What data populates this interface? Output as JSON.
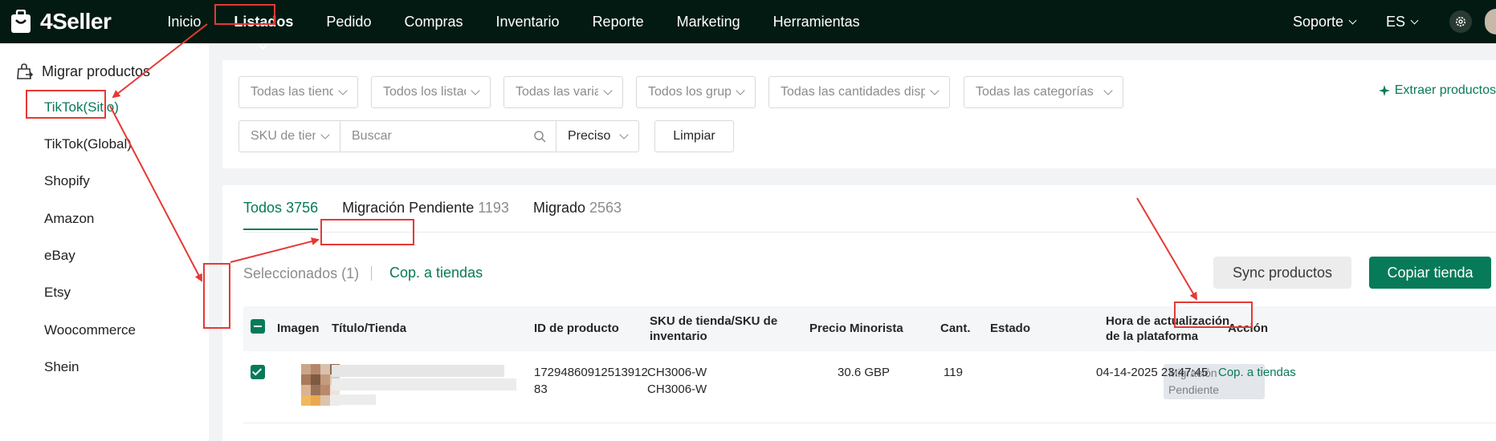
{
  "brand": {
    "name": "4Seller"
  },
  "nav": {
    "items": [
      "Inicio",
      "Listados",
      "Pedido",
      "Compras",
      "Inventario",
      "Reporte",
      "Marketing",
      "Herramientas"
    ],
    "active": "Listados",
    "support": "Soporte",
    "language": "ES"
  },
  "sidebar": {
    "header": "Migrar productos",
    "items": [
      "TikTok(Sitio)",
      "TikTok(Global)",
      "Shopify",
      "Amazon",
      "eBay",
      "Etsy",
      "Woocommerce",
      "Shein"
    ],
    "active": "TikTok(Sitio)"
  },
  "filters": {
    "stores": "Todas las tiendas",
    "listings": "Todos los listados",
    "variants": "Todas las variantes",
    "groups": "Todos los grupos",
    "quantities": "Todas las cantidades disponibles",
    "categories": "Todas las categorías",
    "sku_type": "SKU de tienda",
    "search_placeholder": "Buscar",
    "match": "Preciso",
    "clear": "Limpiar",
    "extract": "Extraer productos"
  },
  "tabs": [
    {
      "label": "Todos",
      "count": "3756"
    },
    {
      "label": "Migración Pendiente",
      "count": "1193"
    },
    {
      "label": "Migrado",
      "count": "2563"
    }
  ],
  "toolbar": {
    "selected": "Seleccionados (1)",
    "copy_link": "Cop. a tiendas",
    "sync": "Sync productos",
    "copy_store": "Copiar tienda"
  },
  "table": {
    "headers": {
      "image": "Imagen",
      "title": "Título/Tienda",
      "product_id": "ID de producto",
      "sku_line1": "SKU de tienda/SKU de",
      "sku_line2": "inventario",
      "price": "Precio Minorista",
      "qty": "Cant.",
      "status": "Estado",
      "updated_line1": "Hora de actualización",
      "updated_line2": "de la plataforma",
      "action": "Acción"
    },
    "rows": [
      {
        "product_id_line1": "17294860912513912",
        "product_id_line2": "83",
        "store_sku": "CH3006-W",
        "inventory_sku": "CH3006-W",
        "price": "30.6 GBP",
        "qty": "119",
        "status_line1": "Migración",
        "status_line2": "Pendiente",
        "updated": "04-14-2025 23:47:45",
        "action": "Cop. a tiendas"
      }
    ]
  },
  "colors": {
    "brand_green": "#077a59",
    "nav_bg": "#021a12",
    "annotation_red": "#e53935"
  }
}
